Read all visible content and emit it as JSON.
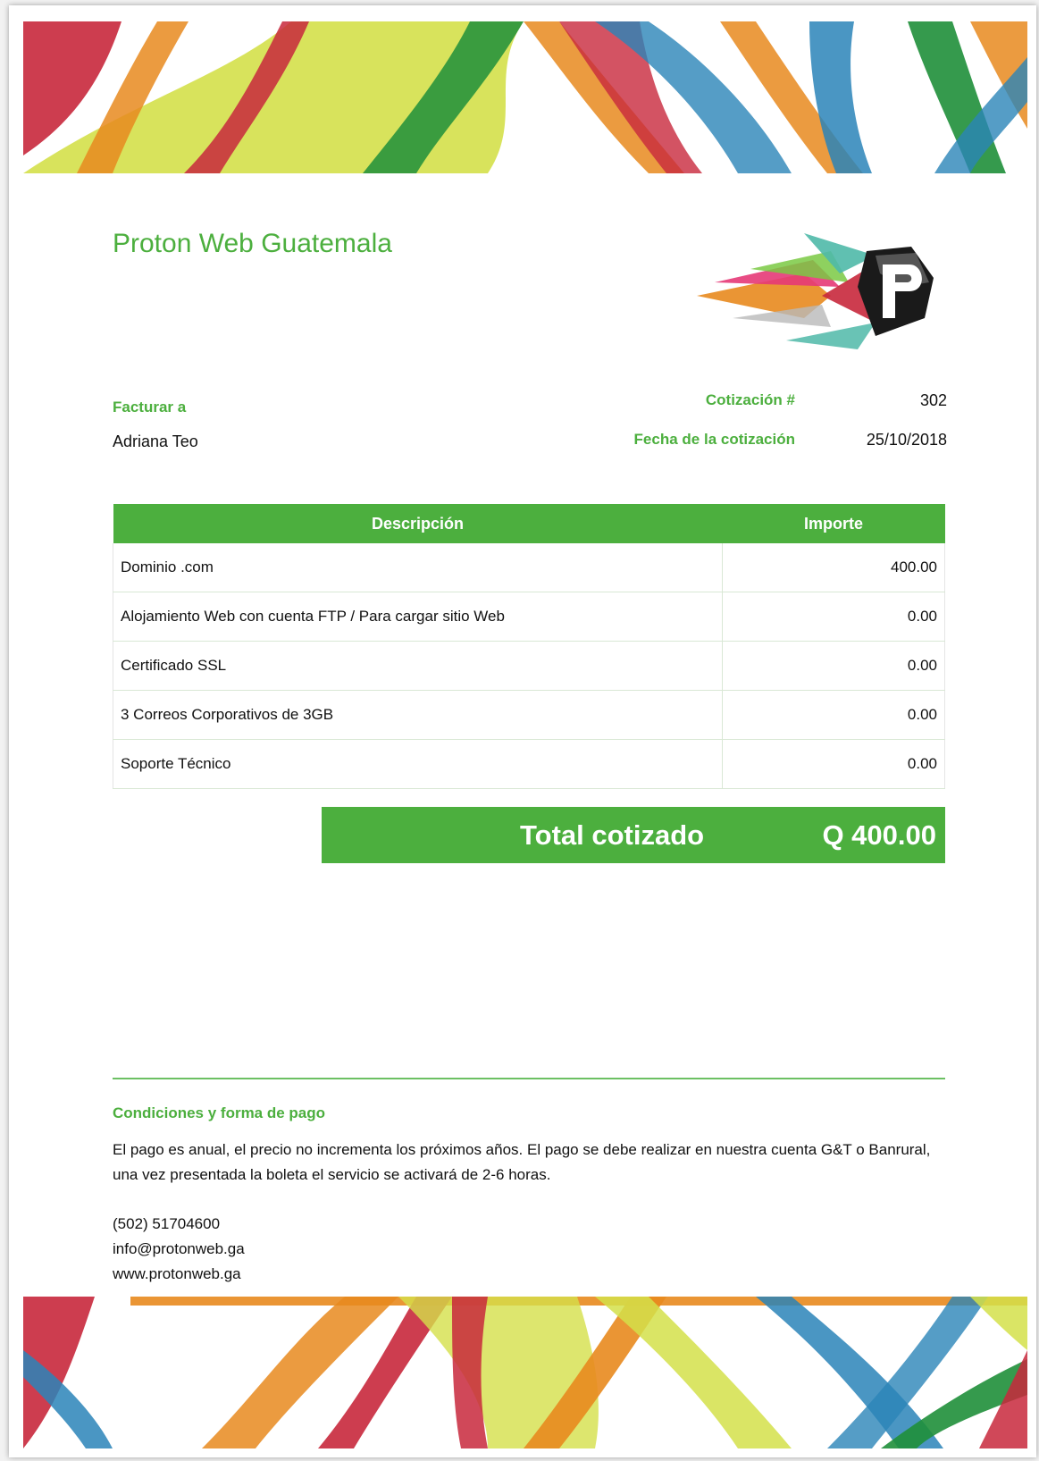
{
  "company": {
    "name": "Proton Web Guatemala"
  },
  "billing": {
    "label": "Facturar a",
    "name": "Adriana Teo"
  },
  "quote": {
    "number_label": "Cotización #",
    "number": "302",
    "date_label": "Fecha de la cotización",
    "date": "25/10/2018"
  },
  "table": {
    "headers": {
      "description": "Descripción",
      "amount": "Importe"
    },
    "rows": [
      {
        "description": "Dominio .com",
        "amount": "400.00"
      },
      {
        "description": "Alojamiento Web con cuenta FTP / Para cargar sitio Web",
        "amount": "0.00"
      },
      {
        "description": "Certificado SSL",
        "amount": "0.00"
      },
      {
        "description": "3 Correos Corporativos de 3GB",
        "amount": "0.00"
      },
      {
        "description": "Soporte Técnico",
        "amount": "0.00"
      }
    ]
  },
  "total": {
    "label": "Total cotizado",
    "value": "Q 400.00"
  },
  "conditions": {
    "title": "Condiciones y forma de pago",
    "text": "El pago es anual, el precio no incrementa los próximos años. El pago se debe realizar en nuestra cuenta G&T o Banrural, una vez presentada la boleta el servicio se activará de 2-6 horas."
  },
  "contact": {
    "phone": "(502) 51704600",
    "email": "info@protonweb.ga",
    "website": "www.protonweb.ga"
  },
  "colors": {
    "accent": "#4caf3e",
    "banner_red": "#c8283c",
    "banner_orange": "#e88a1e",
    "banner_yellow": "#d4e04a",
    "banner_green": "#1f8f3a",
    "banner_blue": "#2a84b8"
  },
  "logo": {
    "icon": "proton-p-logo"
  }
}
